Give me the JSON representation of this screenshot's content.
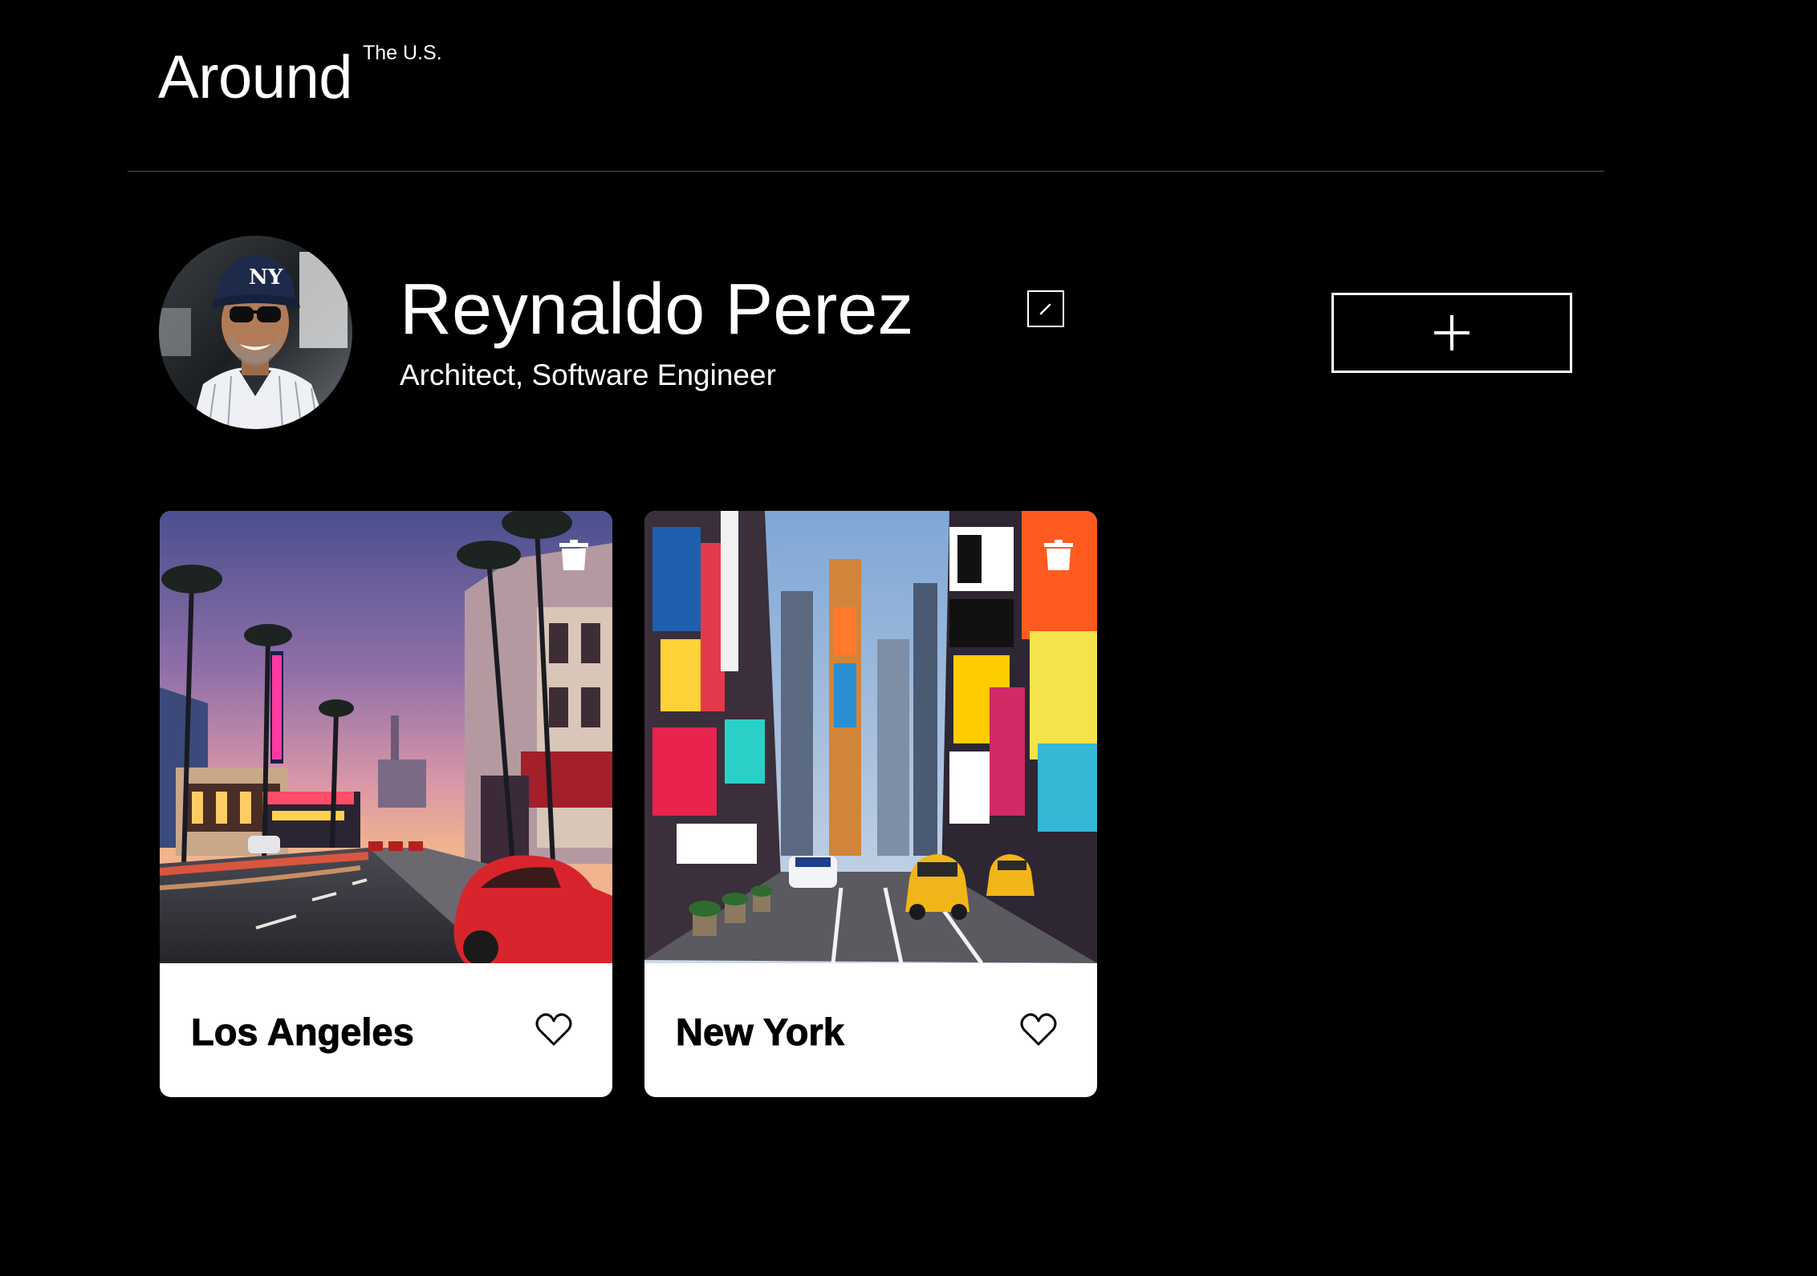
{
  "header": {
    "logo_main": "Around",
    "logo_sup": "The U.S."
  },
  "profile": {
    "name": "Reynaldo Perez",
    "about": "Architect, Software Engineer",
    "edit_icon": "pencil-icon",
    "add_icon": "plus-icon"
  },
  "cards": [
    {
      "title": "Los Angeles",
      "delete_icon": "trash-icon",
      "like_icon": "heart-icon"
    },
    {
      "title": "New York",
      "delete_icon": "trash-icon",
      "like_icon": "heart-icon"
    }
  ],
  "colors": {
    "background": "#000000",
    "text": "#ffffff",
    "card_background": "#ffffff",
    "card_text": "#000000",
    "divider": "#545454"
  }
}
